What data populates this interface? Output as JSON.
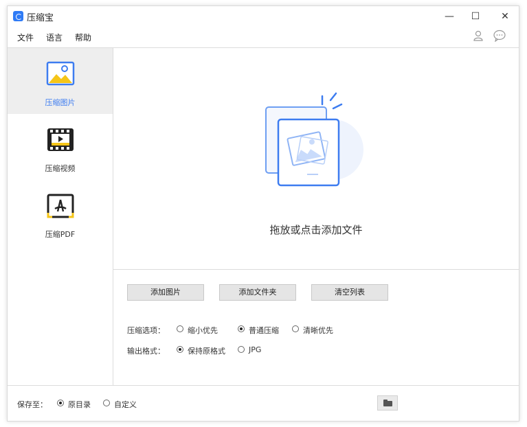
{
  "app": {
    "title": "压缩宝",
    "minimize_symbol": "—",
    "maximize_symbol": "☐",
    "close_symbol": "✕"
  },
  "menu": [
    "文件",
    "语言",
    "帮助"
  ],
  "header_icons": [
    "user-icon",
    "chat-bubble-icon"
  ],
  "sidebar": {
    "items": [
      {
        "label": "压缩图片",
        "icon": "image-icon",
        "active": true
      },
      {
        "label": "压缩视频",
        "icon": "film-icon",
        "active": false
      },
      {
        "label": "压缩PDF",
        "icon": "pdf-icon",
        "active": false
      }
    ]
  },
  "dropzone": {
    "text": "拖放或点击添加文件",
    "icon": "image-stack-icon"
  },
  "actions": {
    "add_image": "添加图片",
    "add_folder": "添加文件夹",
    "clear_list": "清空列表"
  },
  "options": {
    "compress_label": "压缩选项：",
    "compress_choices": [
      {
        "label": "缩小优先",
        "checked": false
      },
      {
        "label": "普通压缩",
        "checked": true
      },
      {
        "label": "清晰优先",
        "checked": false
      }
    ],
    "format_label": "输出格式：",
    "format_choices": [
      {
        "label": "保持原格式",
        "checked": true
      },
      {
        "label": "JPG",
        "checked": false
      }
    ]
  },
  "footer": {
    "save_to_label": "保存至：",
    "save_choices": [
      {
        "label": "原目录",
        "checked": true
      },
      {
        "label": "自定义",
        "checked": false
      }
    ],
    "folder_icon": "folder-icon"
  },
  "colors": {
    "accent": "#3d7cf0",
    "icon_yellow": "#f5c518",
    "active_bg": "#eeeeee",
    "button_bg": "#e5e5e5"
  }
}
